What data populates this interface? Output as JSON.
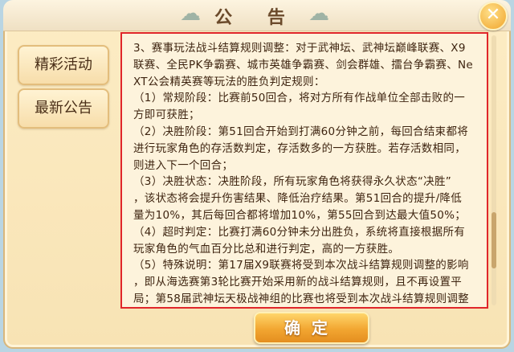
{
  "dialog": {
    "title": "公  告",
    "close_icon": "close-icon",
    "confirm_label": "确定"
  },
  "sidebar": {
    "items": [
      {
        "label": "精彩活动"
      },
      {
        "label": "最新公告"
      }
    ]
  },
  "content": {
    "lines": [
      "3、赛事玩法战斗结算规则调整：对于武神坛、武神坛巅峰联赛、X9",
      "联赛、全民PK争霸赛、城市英雄争霸赛、剑会群雄、擂台争霸赛、Ne",
      "XT公会精英赛等玩法的胜负判定规则：",
      "（1）常规阶段：比赛前50回合，将对方所有作战单位全部击败的一",
      "方即可获胜；",
      "（2）决胜阶段：第51回合开始到打满60分钟之前，每回合结束都将",
      "进行玩家角色的存活数判定，存活数多的一方获胜。若存活数相同，",
      "则进入下一个回合；",
      "（3）决胜状态：决胜阶段，所有玩家角色将获得永久状态“决胜”",
      "，该状态将会提升伤害结果、降低治疗结果。第51回合的提升/降低",
      "量为10%，其后每回合都将增加10%，第55回合到达最大值50%；",
      "（4）超时判定：比赛打满60分钟未分出胜负，系统将直接根据所有",
      "玩家角色的气血百分比总和进行判定，高的一方获胜。",
      "（5）特殊说明：第17届X9联赛将受到本次战斗结算规则调整的影响",
      "，即从海选赛第3轮比赛开始采用新的战斗结算规则，且不再设置平",
      "局；第58届武神坛天极战神组的比赛也将受到本次战斗结算规则调整"
    ]
  }
}
